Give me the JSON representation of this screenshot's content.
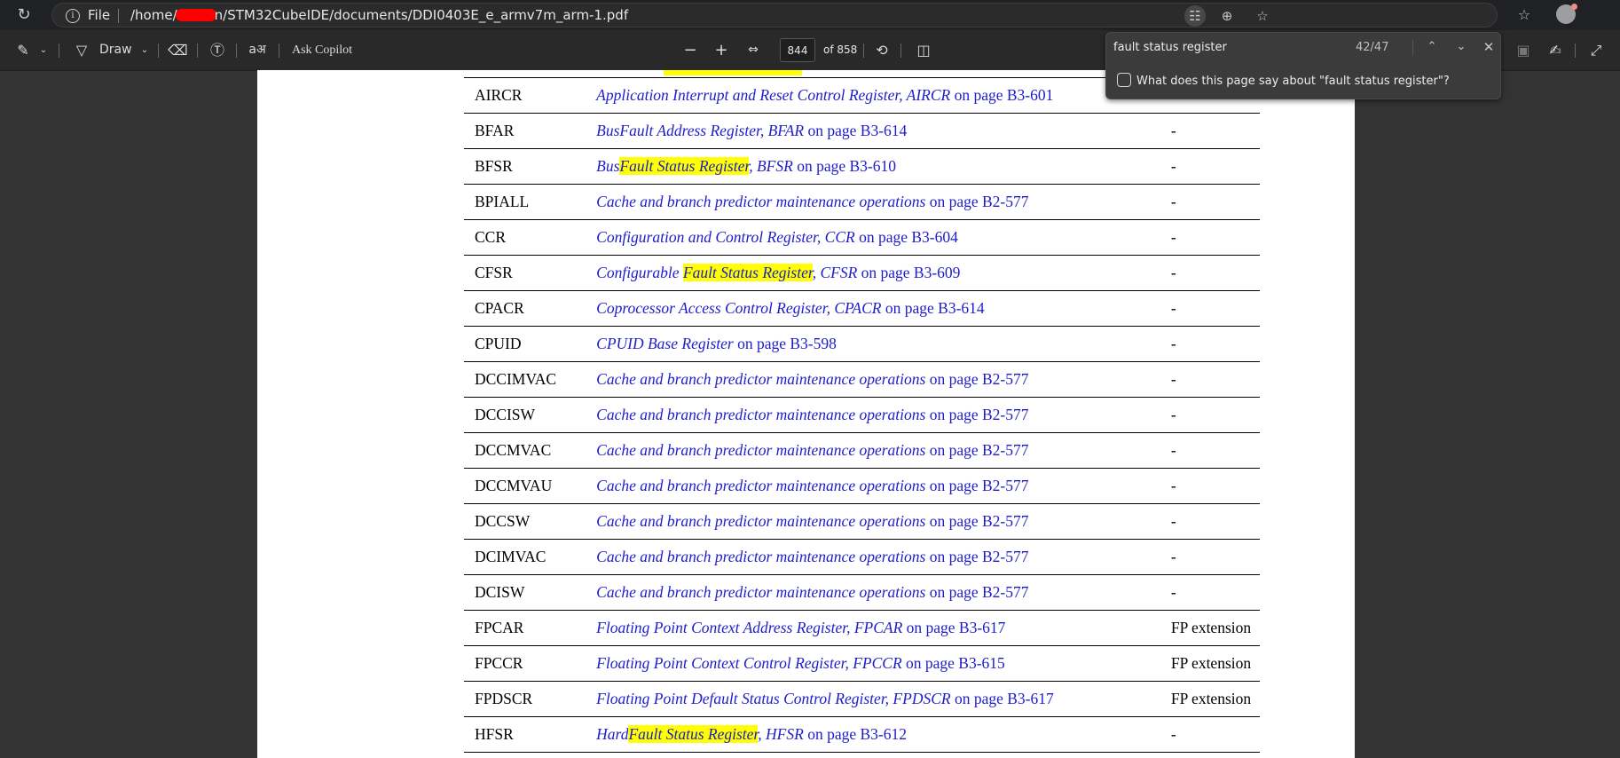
{
  "browser": {
    "file_label": "File",
    "url_prefix": "/home/",
    "url_suffix": "n/STM32CubeIDE/documents/DDI0403E_e_armv7m_arm-1.pdf"
  },
  "toolbar": {
    "draw_label": "Draw",
    "ask_copilot_label": "Ask Copilot",
    "current_page": "844",
    "page_total_label": "of 858"
  },
  "find": {
    "query": "fault status register",
    "count": "42/47",
    "copilot_prompt": "What does this page say about \"fault status register\"?"
  },
  "table": {
    "rows": [
      {
        "reg": "AIRCR",
        "pre": "",
        "hl": "",
        "title": "Application Interrupt and Reset Control Register, AIRCR",
        "page": " on page B3-601",
        "note": ""
      },
      {
        "reg": "BFAR",
        "pre": "",
        "hl": "",
        "title": "BusFault Address Register, BFAR",
        "page": " on page B3-614",
        "note": "-"
      },
      {
        "reg": "BFSR",
        "pre": "Bus",
        "hl": "Fault Status Register",
        "title": ", BFSR",
        "page": " on page B3-610",
        "note": "-"
      },
      {
        "reg": "BPIALL",
        "pre": "",
        "hl": "",
        "title": "Cache and branch predictor maintenance operations",
        "page": " on page B2-577",
        "note": "-"
      },
      {
        "reg": "CCR",
        "pre": "",
        "hl": "",
        "title": "Configuration and Control Register, CCR",
        "page": " on page B3-604",
        "note": "-"
      },
      {
        "reg": "CFSR",
        "pre": "Configurable ",
        "hl": "Fault Status Register",
        "title": ", CFSR",
        "page": " on page B3-609",
        "note": "-"
      },
      {
        "reg": "CPACR",
        "pre": "",
        "hl": "",
        "title": "Coprocessor Access Control Register, CPACR",
        "page": " on page B3-614",
        "note": "-"
      },
      {
        "reg": "CPUID",
        "pre": "",
        "hl": "",
        "title": "CPUID Base Register",
        "page": " on page B3-598",
        "note": "-"
      },
      {
        "reg": "DCCIMVAC",
        "pre": "",
        "hl": "",
        "title": "Cache and branch predictor maintenance operations",
        "page": " on page B2-577",
        "note": "-"
      },
      {
        "reg": "DCCISW",
        "pre": "",
        "hl": "",
        "title": "Cache and branch predictor maintenance operations",
        "page": " on page B2-577",
        "note": "-"
      },
      {
        "reg": "DCCMVAC",
        "pre": "",
        "hl": "",
        "title": "Cache and branch predictor maintenance operations",
        "page": " on page B2-577",
        "note": "-"
      },
      {
        "reg": "DCCMVAU",
        "pre": "",
        "hl": "",
        "title": "Cache and branch predictor maintenance operations",
        "page": " on page B2-577",
        "note": "-"
      },
      {
        "reg": "DCCSW",
        "pre": "",
        "hl": "",
        "title": "Cache and branch predictor maintenance operations",
        "page": " on page B2-577",
        "note": "-"
      },
      {
        "reg": "DCIMVAC",
        "pre": "",
        "hl": "",
        "title": "Cache and branch predictor maintenance operations",
        "page": " on page B2-577",
        "note": "-"
      },
      {
        "reg": "DCISW",
        "pre": "",
        "hl": "",
        "title": "Cache and branch predictor maintenance operations",
        "page": " on page B2-577",
        "note": "-"
      },
      {
        "reg": "FPCAR",
        "pre": "",
        "hl": "",
        "title": "Floating Point Context Address Register, FPCAR",
        "page": " on page B3-617",
        "note": "FP extension"
      },
      {
        "reg": "FPCCR",
        "pre": "",
        "hl": "",
        "title": "Floating Point Context Control Register, FPCCR",
        "page": " on page B3-615",
        "note": "FP extension"
      },
      {
        "reg": "FPDSCR",
        "pre": "",
        "hl": "",
        "title": "Floating Point Default Status Control Register, FPDSCR",
        "page": " on page B3-617",
        "note": "FP extension"
      },
      {
        "reg": "HFSR",
        "pre": "Hard",
        "hl": "Fault Status Register",
        "title": ", HFSR",
        "page": " on page B3-612",
        "note": "-"
      }
    ]
  },
  "icons": {
    "reload": "reload-icon",
    "info": "info-icon",
    "translate": "translate-icon",
    "zoom": "zoom-icon",
    "favorite": "star-icon",
    "favorites": "favorites-icon",
    "highlight": "highlighter-icon",
    "draw": "draw-icon",
    "erase": "eraser-icon",
    "text": "text-icon",
    "read_aloud": "read-aloud-icon",
    "zoom_out": "zoom-out-icon",
    "zoom_in": "zoom-in-icon",
    "fit": "fit-page-icon",
    "rotate": "rotate-icon",
    "page_view": "page-view-icon",
    "save": "save-icon",
    "save_as": "save-as-icon",
    "fullscreen": "fullscreen-icon"
  }
}
